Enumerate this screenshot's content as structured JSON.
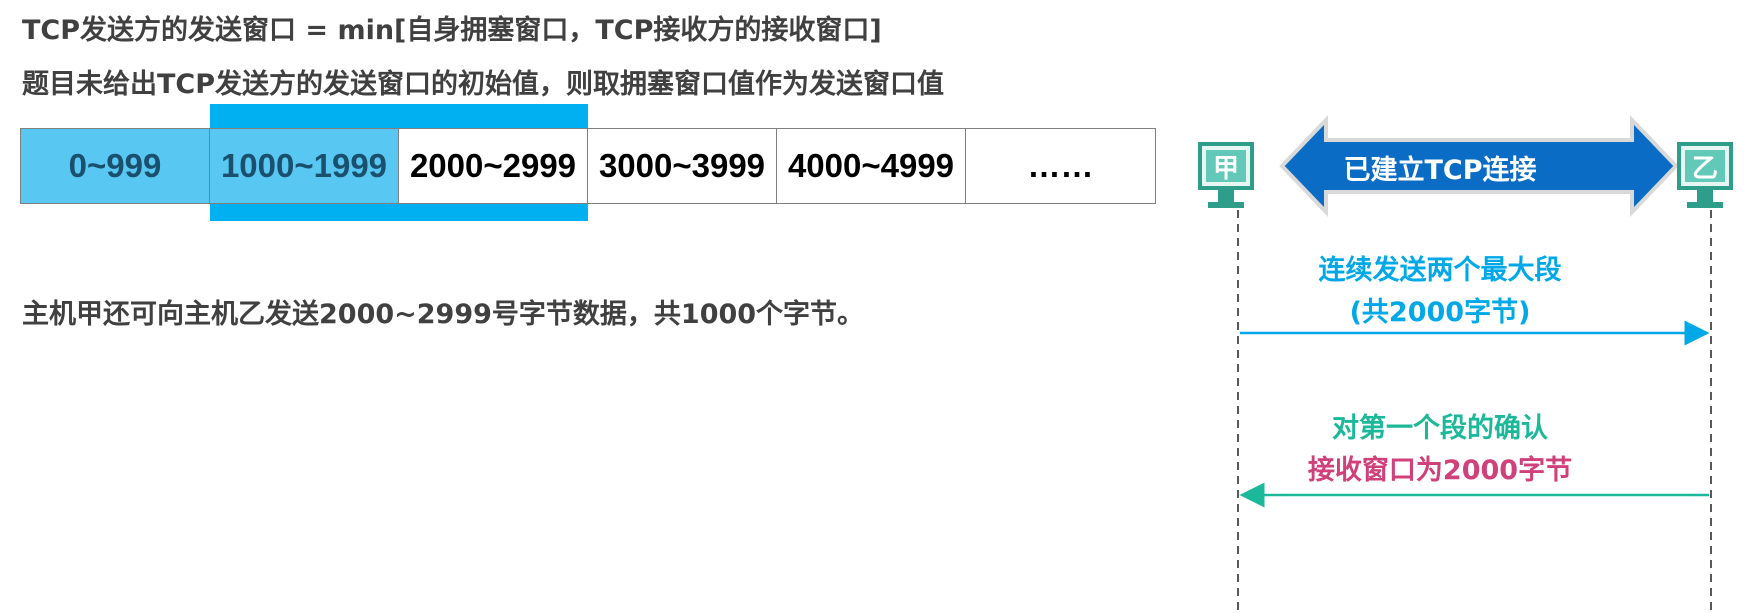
{
  "text": {
    "line1": "TCP发送方的发送窗口 = min[自身拥塞窗口，TCP接收方的接收窗口]",
    "line2": "题目未给出TCP发送方的发送窗口的初始值，则取拥塞窗口值作为发送窗口值",
    "note": "主机甲还可向主机乙发送2000~2999号字节数据，共1000个字节。"
  },
  "sequence": [
    {
      "label": "0~999",
      "state": "sent"
    },
    {
      "label": "1000~1999",
      "state": "sent"
    },
    {
      "label": "2000~2999",
      "state": "plain"
    },
    {
      "label": "3000~3999",
      "state": "plain"
    },
    {
      "label": "4000~4999",
      "state": "plain"
    },
    {
      "label": "……",
      "state": "plain"
    }
  ],
  "hosts": {
    "a": "甲",
    "b": "乙"
  },
  "connection": {
    "label": "已建立TCP连接"
  },
  "messages": {
    "m1_line1": "连续发送两个最大段",
    "m1_line2": "(共2000字节)",
    "m2_line1": "对第一个段的确认",
    "m2_line2": "接收窗口为2000字节"
  },
  "colors": {
    "window_frame": "#00b0f0",
    "sent_fill": "#58c8f2",
    "connection_arrow": "#0a6cc4",
    "host": "#2e9e8a",
    "msg1": "#00a8e8",
    "msg2_ack": "#1cb89a",
    "msg2_window": "#d0407a"
  }
}
